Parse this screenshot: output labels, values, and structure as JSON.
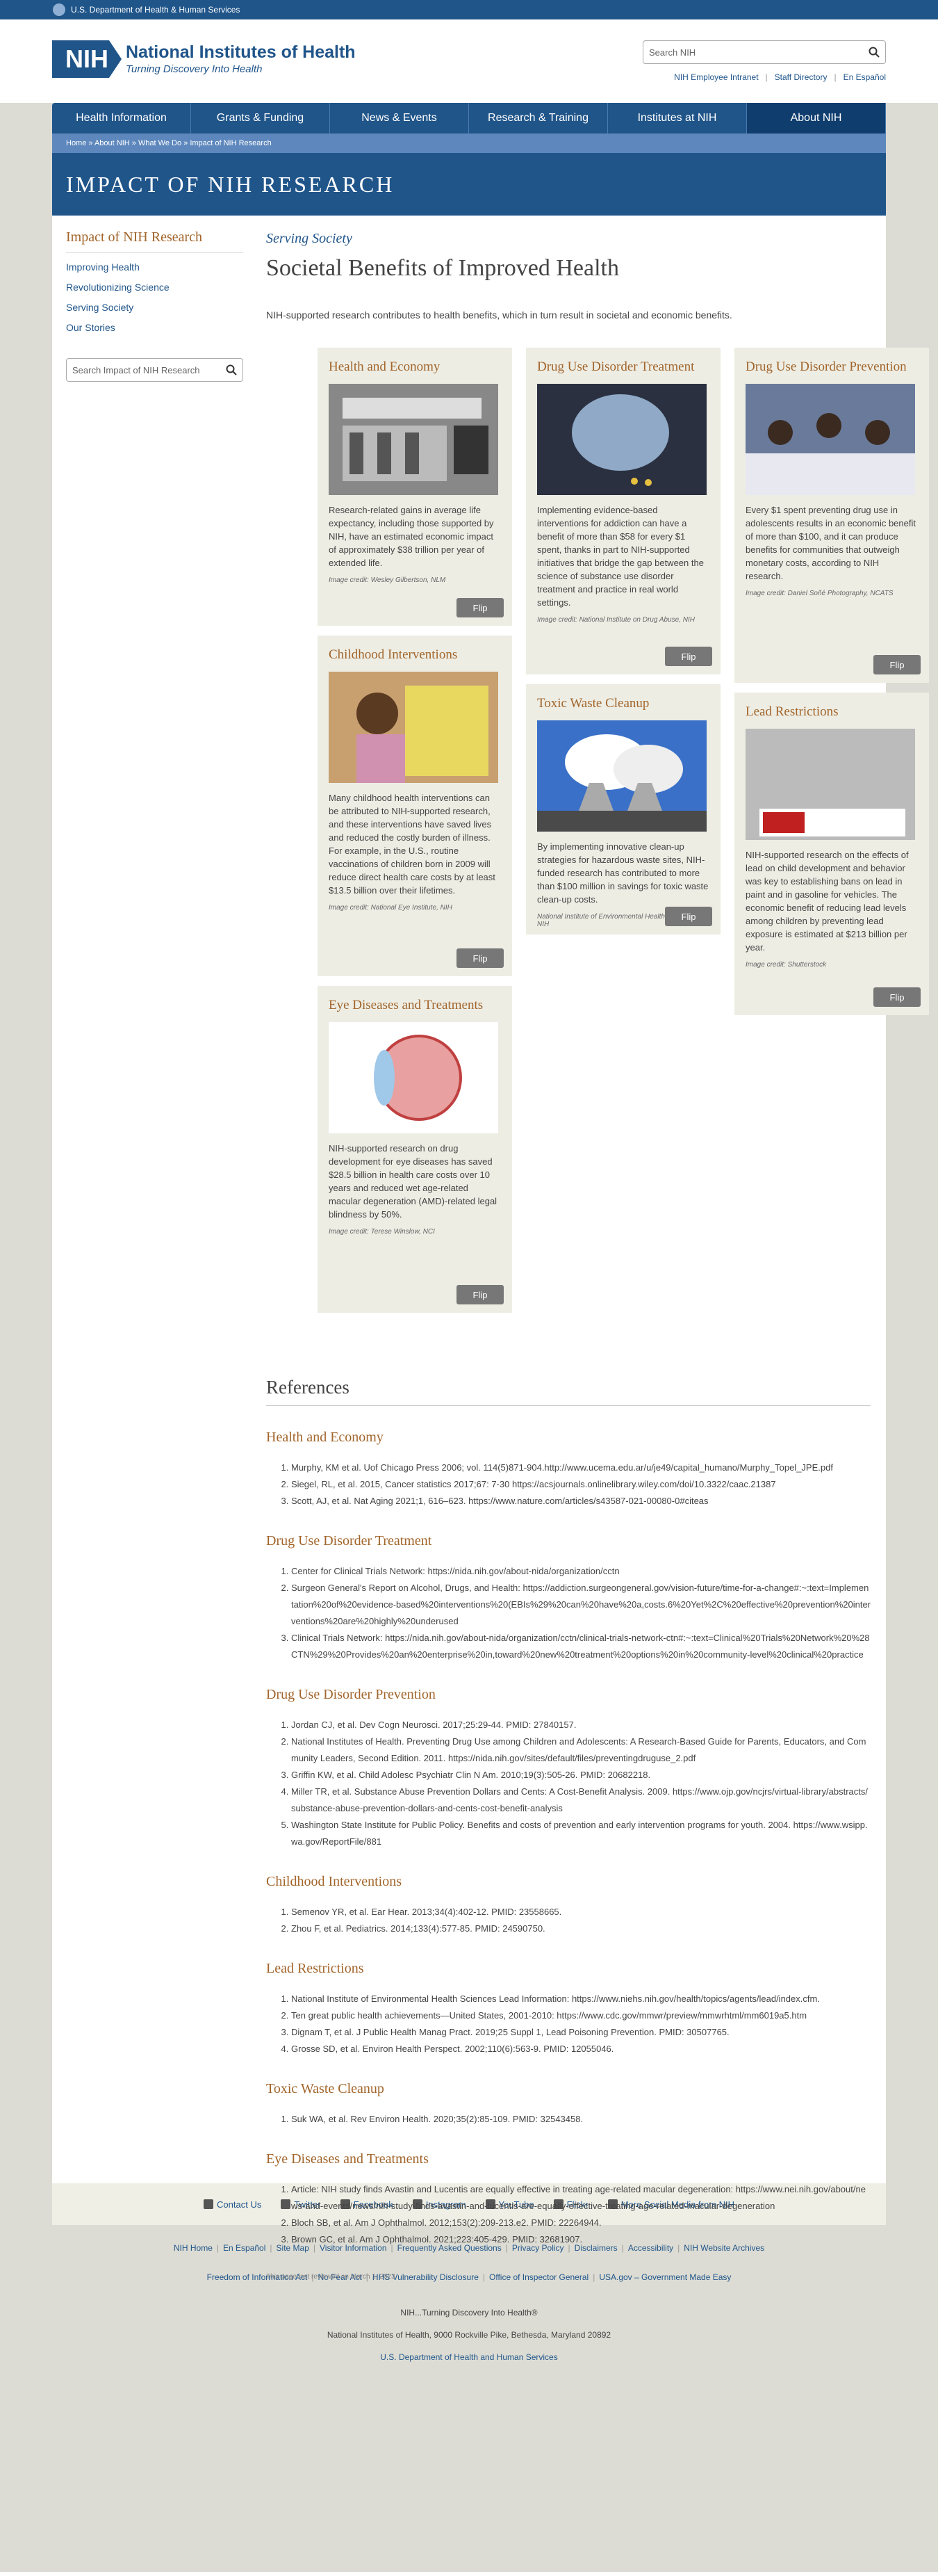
{
  "hhs": "U.S. Department of Health & Human Services",
  "logo": {
    "mark": "NIH",
    "name": "National Institutes of Health",
    "tagline": "Turning Discovery Into Health"
  },
  "search": {
    "placeholder": "Search NIH"
  },
  "toplinks": [
    "NIH Employee Intranet",
    "Staff Directory",
    "En Español"
  ],
  "nav": [
    "Health Information",
    "Grants & Funding",
    "News & Events",
    "Research & Training",
    "Institutes at NIH",
    "About NIH"
  ],
  "breadcrumb": "Home » About NIH » What We Do » Impact of NIH Research",
  "banner": "IMPACT OF NIH RESEARCH",
  "sidebar": {
    "title": "Impact of NIH Research",
    "items": [
      "Improving Health",
      "Revolutionizing Science",
      "Serving Society",
      "Our Stories"
    ],
    "search_placeholder": "Search Impact of NIH Research"
  },
  "page": {
    "kicker": "Serving Society",
    "title": "Societal Benefits of Improved Health",
    "intro": "NIH-supported research contributes to health benefits, which in turn result in societal and economic benefits."
  },
  "cards": {
    "health": {
      "title": "Health and Economy",
      "text": "Research-related gains in average life expectancy, including those supported by NIH, have an estimated economic impact of approximately $38 trillion per year of extended life.",
      "credit": "Image credit: Wesley Gilbertson, NLM"
    },
    "drug": {
      "title": "Drug Use Disorder Treatment",
      "text": "Implementing evidence-based interventions for addiction can have a benefit of more than $58 for every $1 spent, thanks in part to NIH-supported initiatives that bridge the gap between the science of substance use disorder treatment and practice in real world settings.",
      "credit": "Image credit: National Institute on Drug Abuse, NIH"
    },
    "prevention": {
      "title": "Drug Use Disorder Prevention",
      "text": "Every $1 spent preventing drug use in adolescents results in an economic benefit of more than $100, and it can produce benefits for communities that outweigh monetary costs, according to NIH research.",
      "credit": "Image credit: Daniel Soñé Photography, NCATS"
    },
    "childhood": {
      "title": "Childhood Interventions",
      "text": "Many childhood health interventions can be attributed to NIH-supported research, and these interventions have saved lives and reduced the costly burden of illness. For example, in the U.S., routine vaccinations of children born in 2009 will reduce direct health care costs by at least $13.5 billion over their lifetimes.",
      "credit": "Image credit: National Eye Institute, NIH"
    },
    "toxic": {
      "title": "Toxic Waste Cleanup",
      "text": "By implementing innovative clean-up strategies for hazardous waste sites, NIH-funded research has contributed to more than $100 million in savings for toxic waste clean-up costs.",
      "credit": "National Institute of Environmental Health Sciences, NIH"
    },
    "lead": {
      "title": "Lead Restrictions",
      "text": "NIH-supported research on the effects of lead on child development and behavior was key to establishing bans on lead in paint and in gasoline for vehicles. The economic benefit of reducing lead levels among children by preventing lead exposure is estimated at $213 billion per year.",
      "credit": "Image credit: Shutterstock"
    },
    "eye": {
      "title": "Eye Diseases and Treatments",
      "text": "NIH-supported research on drug development for eye diseases has saved $28.5 billion in health care costs over 10 years and reduced wet age-related macular degeneration (AMD)-related legal blindness by 50%.",
      "credit": "Image credit: Terese Winslow, NCI"
    }
  },
  "flip": "Flip",
  "references": {
    "title": "References",
    "sections": [
      {
        "heading": "Health and Economy",
        "items": [
          "Murphy, KM et al. Uof Chicago Press 2006; vol. 114(5)871-904.http://www.ucema.edu.ar/u/je49/capital_humano/Murphy_Topel_JPE.pdf",
          "Siegel, RL, et al. 2015, Cancer statistics 2017;67: 7-30 https://acsjournals.onlinelibrary.wiley.com/doi/10.3322/caac.21387",
          "Scott, AJ, et al. Nat Aging 2021;1, 616–623. https://www.nature.com/articles/s43587-021-00080-0#citeas"
        ]
      },
      {
        "heading": "Drug Use Disorder Treatment",
        "items": [
          "Center for Clinical Trials Network: https://nida.nih.gov/about-nida/organization/cctn",
          "Surgeon General's Report on Alcohol, Drugs, and Health: https://addiction.surgeongeneral.gov/vision-future/time-for-a-change#:~:text=Implementation%20of%20evidence-based%20interventions%20(EBIs%29%20can%20have%20a,costs.6%20Yet%2C%20effective%20prevention%20interventions%20are%20highly%20underused",
          "Clinical Trials Network: https://nida.nih.gov/about-nida/organization/cctn/clinical-trials-network-ctn#:~:text=Clinical%20Trials%20Network%20%28CTN%29%20Provides%20an%20enterprise%20in,toward%20new%20treatment%20options%20in%20community-level%20clinical%20practice"
        ]
      },
      {
        "heading": "Drug Use Disorder Prevention",
        "items": [
          "Jordan CJ, et al. Dev Cogn Neurosci. 2017;25:29-44. PMID: 27840157.",
          "National Institutes of Health. Preventing Drug Use among Children and Adolescents: A Research-Based Guide for Parents, Educators, and Community Leaders, Second Edition. 2011. https://nida.nih.gov/sites/default/files/preventingdruguse_2.pdf",
          "Griffin KW, et al. Child Adolesc Psychiatr Clin N Am. 2010;19(3):505-26. PMID: 20682218.",
          "Miller TR, et al. Substance Abuse Prevention Dollars and Cents: A Cost-Benefit Analysis. 2009. https://www.ojp.gov/ncjrs/virtual-library/abstracts/substance-abuse-prevention-dollars-and-cents-cost-benefit-analysis",
          "Washington State Institute for Public Policy. Benefits and costs of prevention and early intervention programs for youth. 2004. https://www.wsipp.wa.gov/ReportFile/881"
        ]
      },
      {
        "heading": "Childhood Interventions",
        "items": [
          "Semenov YR, et al. Ear Hear. 2013;34(4):402-12. PMID: 23558665.",
          "Zhou F, et al. Pediatrics. 2014;133(4):577-85. PMID: 24590750."
        ]
      },
      {
        "heading": "Lead Restrictions",
        "items": [
          "National Institute of Environmental Health Sciences Lead Information: https://www.niehs.nih.gov/health/topics/agents/lead/index.cfm.",
          "Ten great public health achievements—United States, 2001-2010: https://www.cdc.gov/mmwr/preview/mmwrhtml/mm6019a5.htm",
          "Dignam T, et al. J Public Health Manag Pract. 2019;25 Suppl 1, Lead Poisoning Prevention. PMID: 30507765.",
          "Grosse SD, et al. Environ Health Perspect. 2002;110(6):563-9. PMID: 12055046."
        ]
      },
      {
        "heading": "Toxic Waste Cleanup",
        "items": [
          "Suk WA, et al. Rev Environ Health. 2020;35(2):85-109. PMID: 32543458."
        ]
      },
      {
        "heading": "Eye Diseases and Treatments",
        "items": [
          "Article: NIH study finds Avastin and Lucentis are equally effective in treating age-related macular degeneration: https://www.nei.nih.gov/about/news-and-events/news/nih-study-finds-avastin-and-lucentis-are-equally-effective-treating-age-related-macular-degeneration",
          "Bloch SB, et al. Am J Ophthalmol. 2012;153(2):209-213.e2. PMID: 22264944.",
          "Brown GC, et al. Am J Ophthalmol. 2021;223:405-429. PMID: 32681907."
        ]
      }
    ],
    "reviewed": "This page last reviewed on March 1, 2023"
  },
  "social": [
    "Contact Us",
    "Twitter",
    "Facebook",
    "Instagram",
    "YouTube",
    "Flickr",
    "More Social Media from NIH"
  ],
  "footer_row1": [
    "NIH Home",
    "En Español",
    "Site Map",
    "Visitor Information",
    "Frequently Asked Questions",
    "Privacy Policy",
    "Disclaimers",
    "Accessibility",
    "NIH Website Archives"
  ],
  "footer_row2": [
    "Freedom of Information Act",
    "No Fear Act",
    "HHS Vulnerability Disclosure",
    "Office of Inspector General",
    "USA.gov – Government Made Easy"
  ],
  "footer_tag": "NIH...Turning Discovery Into Health®",
  "footer_address": "National Institutes of Health, 9000 Rockville Pike, Bethesda, Maryland 20892",
  "footer_hhs": "U.S. Department of Health and Human Services"
}
